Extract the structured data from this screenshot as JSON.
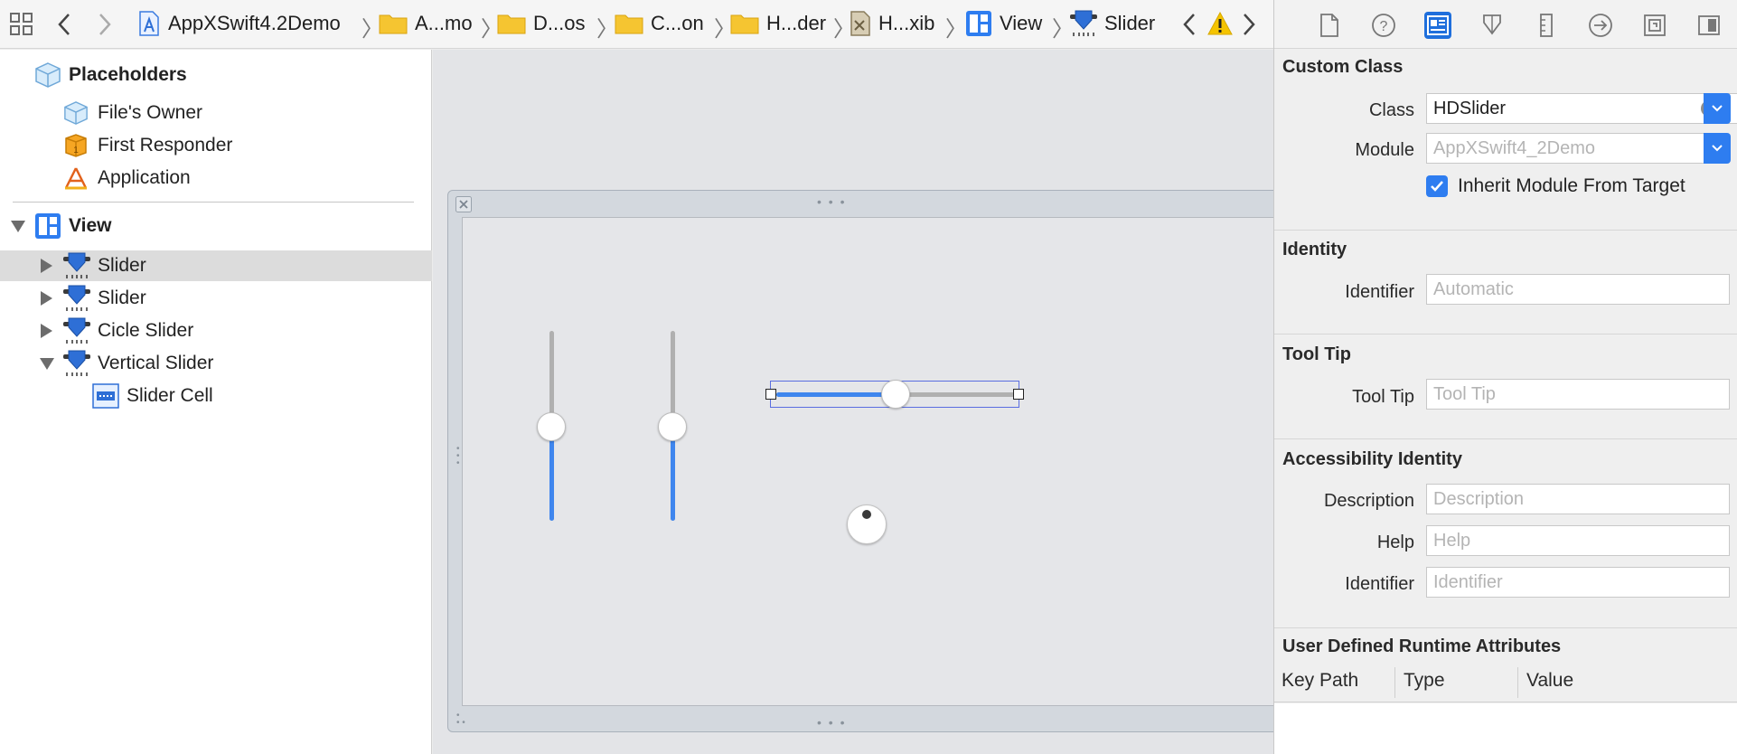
{
  "jumpbar": {
    "project": "AppXSwift4.2Demo",
    "crumbs": [
      "A...mo",
      "D...os",
      "C...on",
      "H...der",
      "H...xib"
    ],
    "view": "View",
    "slider": "Slider"
  },
  "outline": {
    "placeholders": "Placeholders",
    "files_owner": "File's Owner",
    "first_responder": "First Responder",
    "application": "Application",
    "view": "View",
    "items": [
      "Slider",
      "Slider",
      "Cicle Slider",
      "Vertical Slider"
    ],
    "slider_cell": "Slider Cell"
  },
  "canvas": {
    "vertical_slider_1_value": 0.5,
    "vertical_slider_2_value": 0.5,
    "horizontal_slider_value": 0.5
  },
  "inspector": {
    "custom_class": {
      "title": "Custom Class",
      "class_label": "Class",
      "class_value": "HDSlider",
      "module_label": "Module",
      "module_placeholder": "AppXSwift4_2Demo",
      "inherit_label": "Inherit Module From Target",
      "inherit_checked": true
    },
    "identity": {
      "title": "Identity",
      "identifier_label": "Identifier",
      "identifier_placeholder": "Automatic"
    },
    "tooltip": {
      "title": "Tool Tip",
      "label": "Tool Tip",
      "placeholder": "Tool Tip"
    },
    "accessibility": {
      "title": "Accessibility Identity",
      "description_label": "Description",
      "description_placeholder": "Description",
      "help_label": "Help",
      "help_placeholder": "Help",
      "identifier_label": "Identifier",
      "identifier_placeholder": "Identifier"
    },
    "runtime": {
      "title": "User Defined Runtime Attributes",
      "columns": [
        "Key Path",
        "Type",
        "Value"
      ]
    }
  },
  "colors": {
    "accent": "#1f6fdc",
    "slider_fill": "#3f86ee",
    "slider_track": "#b0b0b0",
    "warning": "#f5c400"
  },
  "icons": [
    "grid-icon",
    "back-icon",
    "forward-icon",
    "project-icon",
    "folder-icon",
    "xib-icon",
    "view-icon",
    "slider-icon",
    "warning-icon",
    "file-icon",
    "help-icon",
    "identity-icon",
    "attributes-icon",
    "size-icon",
    "connections-icon",
    "bindings-icon",
    "effects-icon"
  ]
}
